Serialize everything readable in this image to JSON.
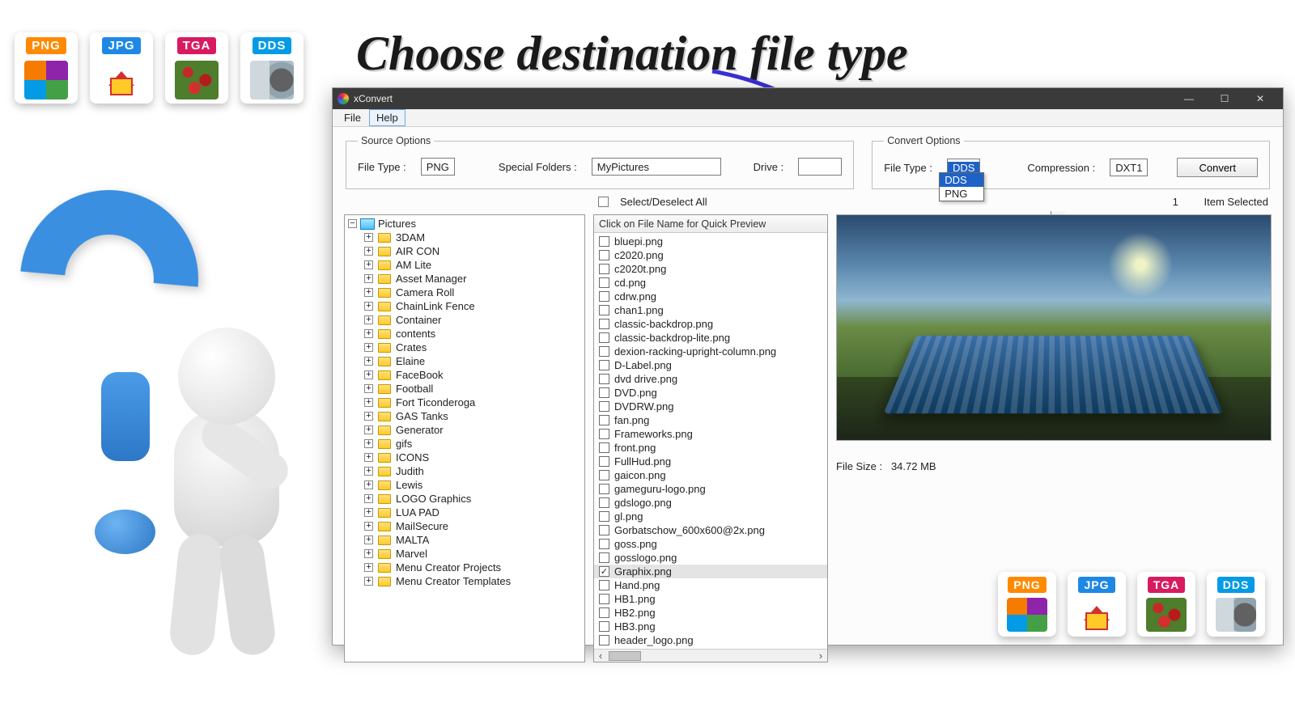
{
  "headline": "Choose destination file type",
  "formats": [
    "PNG",
    "JPG",
    "TGA",
    "DDS"
  ],
  "app": {
    "title": "xConvert",
    "menu": {
      "file": "File",
      "help": "Help"
    },
    "source": {
      "legend": "Source Options",
      "filetype_label": "File Type :",
      "filetype_value": "PNG",
      "specialfolders_label": "Special Folders :",
      "specialfolders_value": "MyPictures",
      "drive_label": "Drive :",
      "drive_value": ""
    },
    "convert": {
      "legend": "Convert Options",
      "filetype_label": "File Type :",
      "filetype_value": "DDS",
      "compression_label": "Compression :",
      "compression_value": "DXT1",
      "button": "Convert",
      "dropdown": {
        "opt1": "DDS",
        "opt2": "PNG"
      }
    },
    "selectbar": {
      "selectall": "Select/Deselect All",
      "count": "1",
      "count_label": "Item Selected"
    },
    "tree": {
      "root": "Pictures",
      "items": [
        "3DAM",
        "AIR CON",
        "AM Lite",
        "Asset Manager",
        "Camera Roll",
        "ChainLink Fence",
        "Container",
        "contents",
        "Crates",
        "Elaine",
        "FaceBook",
        "Football",
        "Fort Ticonderoga",
        "GAS Tanks",
        "Generator",
        "gifs",
        "ICONS",
        "Judith",
        "Lewis",
        "LOGO Graphics",
        "LUA PAD",
        "MailSecure",
        "MALTA",
        "Marvel",
        "Menu Creator Projects",
        "Menu Creator Templates"
      ]
    },
    "list": {
      "header": "Click on File Name for Quick Preview",
      "items": [
        {
          "n": "bluepi.png",
          "c": false
        },
        {
          "n": "c2020.png",
          "c": false
        },
        {
          "n": "c2020t.png",
          "c": false
        },
        {
          "n": "cd.png",
          "c": false
        },
        {
          "n": "cdrw.png",
          "c": false
        },
        {
          "n": "chan1.png",
          "c": false
        },
        {
          "n": "classic-backdrop.png",
          "c": false
        },
        {
          "n": "classic-backdrop-lite.png",
          "c": false
        },
        {
          "n": "dexion-racking-upright-column.png",
          "c": false
        },
        {
          "n": "D-Label.png",
          "c": false
        },
        {
          "n": "dvd drive.png",
          "c": false
        },
        {
          "n": "DVD.png",
          "c": false
        },
        {
          "n": "DVDRW.png",
          "c": false
        },
        {
          "n": "fan.png",
          "c": false
        },
        {
          "n": "Frameworks.png",
          "c": false
        },
        {
          "n": "front.png",
          "c": false
        },
        {
          "n": "FullHud.png",
          "c": false
        },
        {
          "n": "gaicon.png",
          "c": false
        },
        {
          "n": "gameguru-logo.png",
          "c": false
        },
        {
          "n": "gdslogo.png",
          "c": false
        },
        {
          "n": "gl.png",
          "c": false
        },
        {
          "n": "Gorbatschow_600x600@2x.png",
          "c": false
        },
        {
          "n": "goss.png",
          "c": false
        },
        {
          "n": "gosslogo.png",
          "c": false
        },
        {
          "n": "Graphix.png",
          "c": true
        },
        {
          "n": "Hand.png",
          "c": false
        },
        {
          "n": "HB1.png",
          "c": false
        },
        {
          "n": "HB2.png",
          "c": false
        },
        {
          "n": "HB3.png",
          "c": false
        },
        {
          "n": "header_logo.png",
          "c": false
        }
      ]
    },
    "preview": {
      "filesize_label": "File Size :",
      "filesize_value": "34.72 MB"
    }
  }
}
